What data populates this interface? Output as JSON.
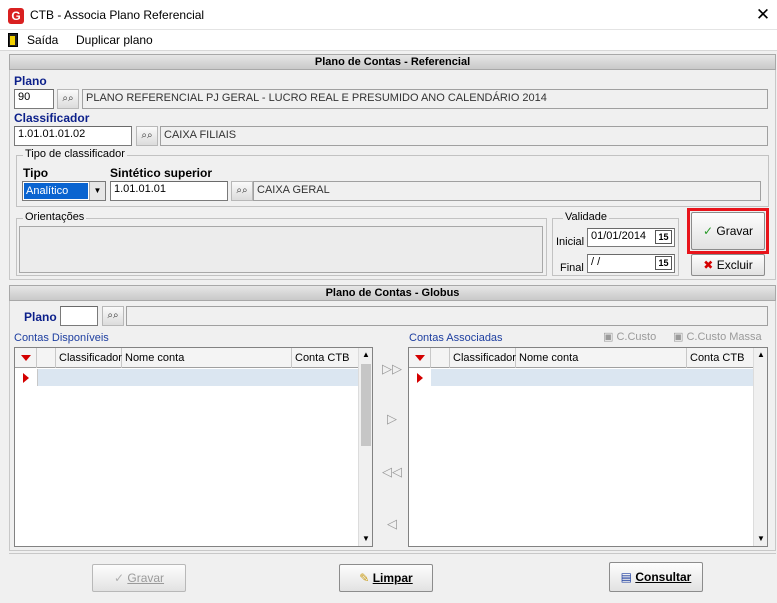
{
  "window": {
    "title": "CTB - Associa Plano Referencial",
    "close_glyph": "✕"
  },
  "menu": {
    "exit_label": "Saída",
    "duplicate_label": "Duplicar plano"
  },
  "referencial": {
    "header": "Plano de Contas - Referencial",
    "plano_label": "Plano",
    "plano_value": "90",
    "plano_desc": "PLANO REFERENCIAL PJ GERAL - LUCRO REAL E PRESUMIDO ANO CALENDÁRIO 2014",
    "classificador_label": "Classificador",
    "classificador_value": "1.01.01.01.02",
    "classificador_desc": "CAIXA FILIAIS",
    "tipo_group_label": "Tipo de classificador",
    "tipo_label": "Tipo",
    "tipo_value": "Analítico",
    "sintetico_label": "Sintético superior",
    "sintetico_value": "1.01.01.01",
    "sintetico_desc": "CAIXA GERAL",
    "orientacoes_label": "Orientações",
    "validade_label": "Validade",
    "inicial_label": "Inicial",
    "inicial_value": "01/01/2014",
    "final_label": "Final",
    "final_value": " / /",
    "cal_icon": "15",
    "gravar_label": "Gravar",
    "excluir_label": "Excluir"
  },
  "globus": {
    "header": "Plano de Contas - Globus",
    "plano_label": "Plano",
    "disponiveis_label": "Contas Disponíveis",
    "associadas_label": "Contas Associadas",
    "ccusto_label": "C.Custo",
    "ccusto_massa_label": "C.Custo Massa",
    "columns": [
      "Classificador",
      "Nome conta",
      "Conta CTB"
    ]
  },
  "transfer": {
    "all_right": "▷▷",
    "right": "▷",
    "all_left": "◁◁",
    "left": "◁"
  },
  "footer": {
    "gravar_label": "Gravar",
    "limpar_label": "Limpar",
    "consultar_label": "Consultar"
  },
  "colors": {
    "accent": "#0b1f8a",
    "highlight": "#e8141b",
    "row_select": "#dbe6f1"
  }
}
